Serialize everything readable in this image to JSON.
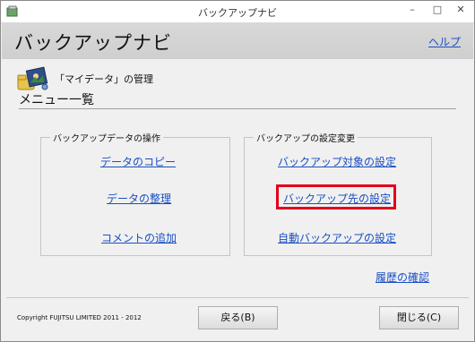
{
  "window": {
    "title": "バックアップナビ",
    "controls": {
      "minimize": "–",
      "maximize": "□",
      "close": "✕"
    }
  },
  "header": {
    "title": "バックアップナビ",
    "help_link": "ヘルプ"
  },
  "section": {
    "caption": "「マイデータ」の管理",
    "heading": "メニュー一覧"
  },
  "groups": {
    "data_ops": {
      "legend": "バックアップデータの操作",
      "links": [
        "データのコピー",
        "データの整理",
        "コメントの追加"
      ]
    },
    "backup_settings": {
      "legend": "バックアップの設定変更",
      "links": [
        "バックアップ対象の設定",
        "バックアップ先の設定",
        "自動バックアップの設定"
      ]
    }
  },
  "history_link": "履歴の確認",
  "footer": {
    "copyright": "Copyright FUJITSU LIMITED 2011 - 2012",
    "back_button": "戻る(B)",
    "close_button": "閉じる(C)"
  },
  "highlight_color": "#e3001b",
  "link_color": "#1a4fc4"
}
